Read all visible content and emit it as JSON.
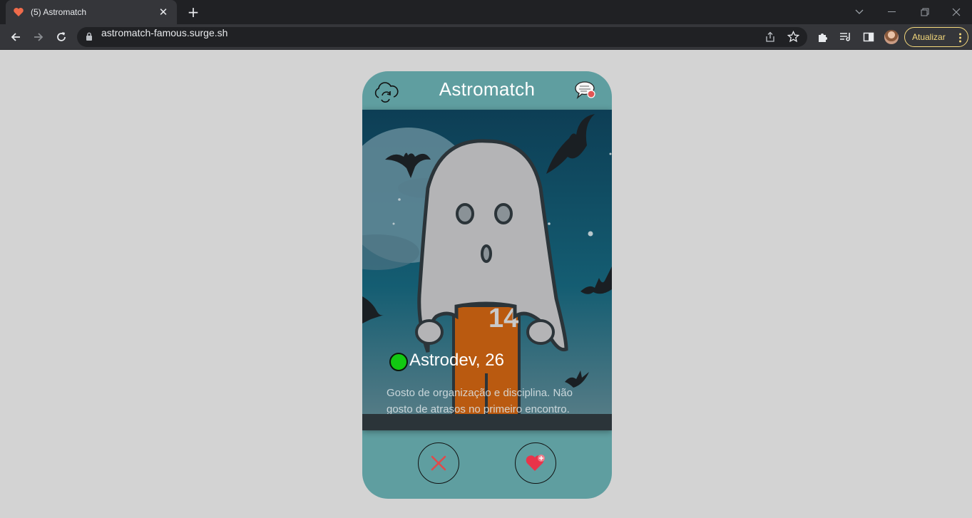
{
  "browser": {
    "tab_title": "(5) Astromatch",
    "tab_close": "✕",
    "new_tab": "+",
    "url": "astromatch-famous.surge.sh",
    "update_label": "Atualizar"
  },
  "app": {
    "title": "Astromatch",
    "profile": {
      "name_age": "Astrodev, 26",
      "bio": "Gosto de organização e disciplina. Não gosto de atrasos no primeiro encontro.",
      "online": true,
      "jersey_number": "14"
    },
    "actions": {
      "reject_icon": "x-icon",
      "like_icon": "heart-plus-icon"
    }
  },
  "colors": {
    "page_bg": "#d3d3d3",
    "app_bg": "#5f9ea0",
    "online": "#12c912",
    "reject": "#e04a4a",
    "like": "#e8344a"
  }
}
